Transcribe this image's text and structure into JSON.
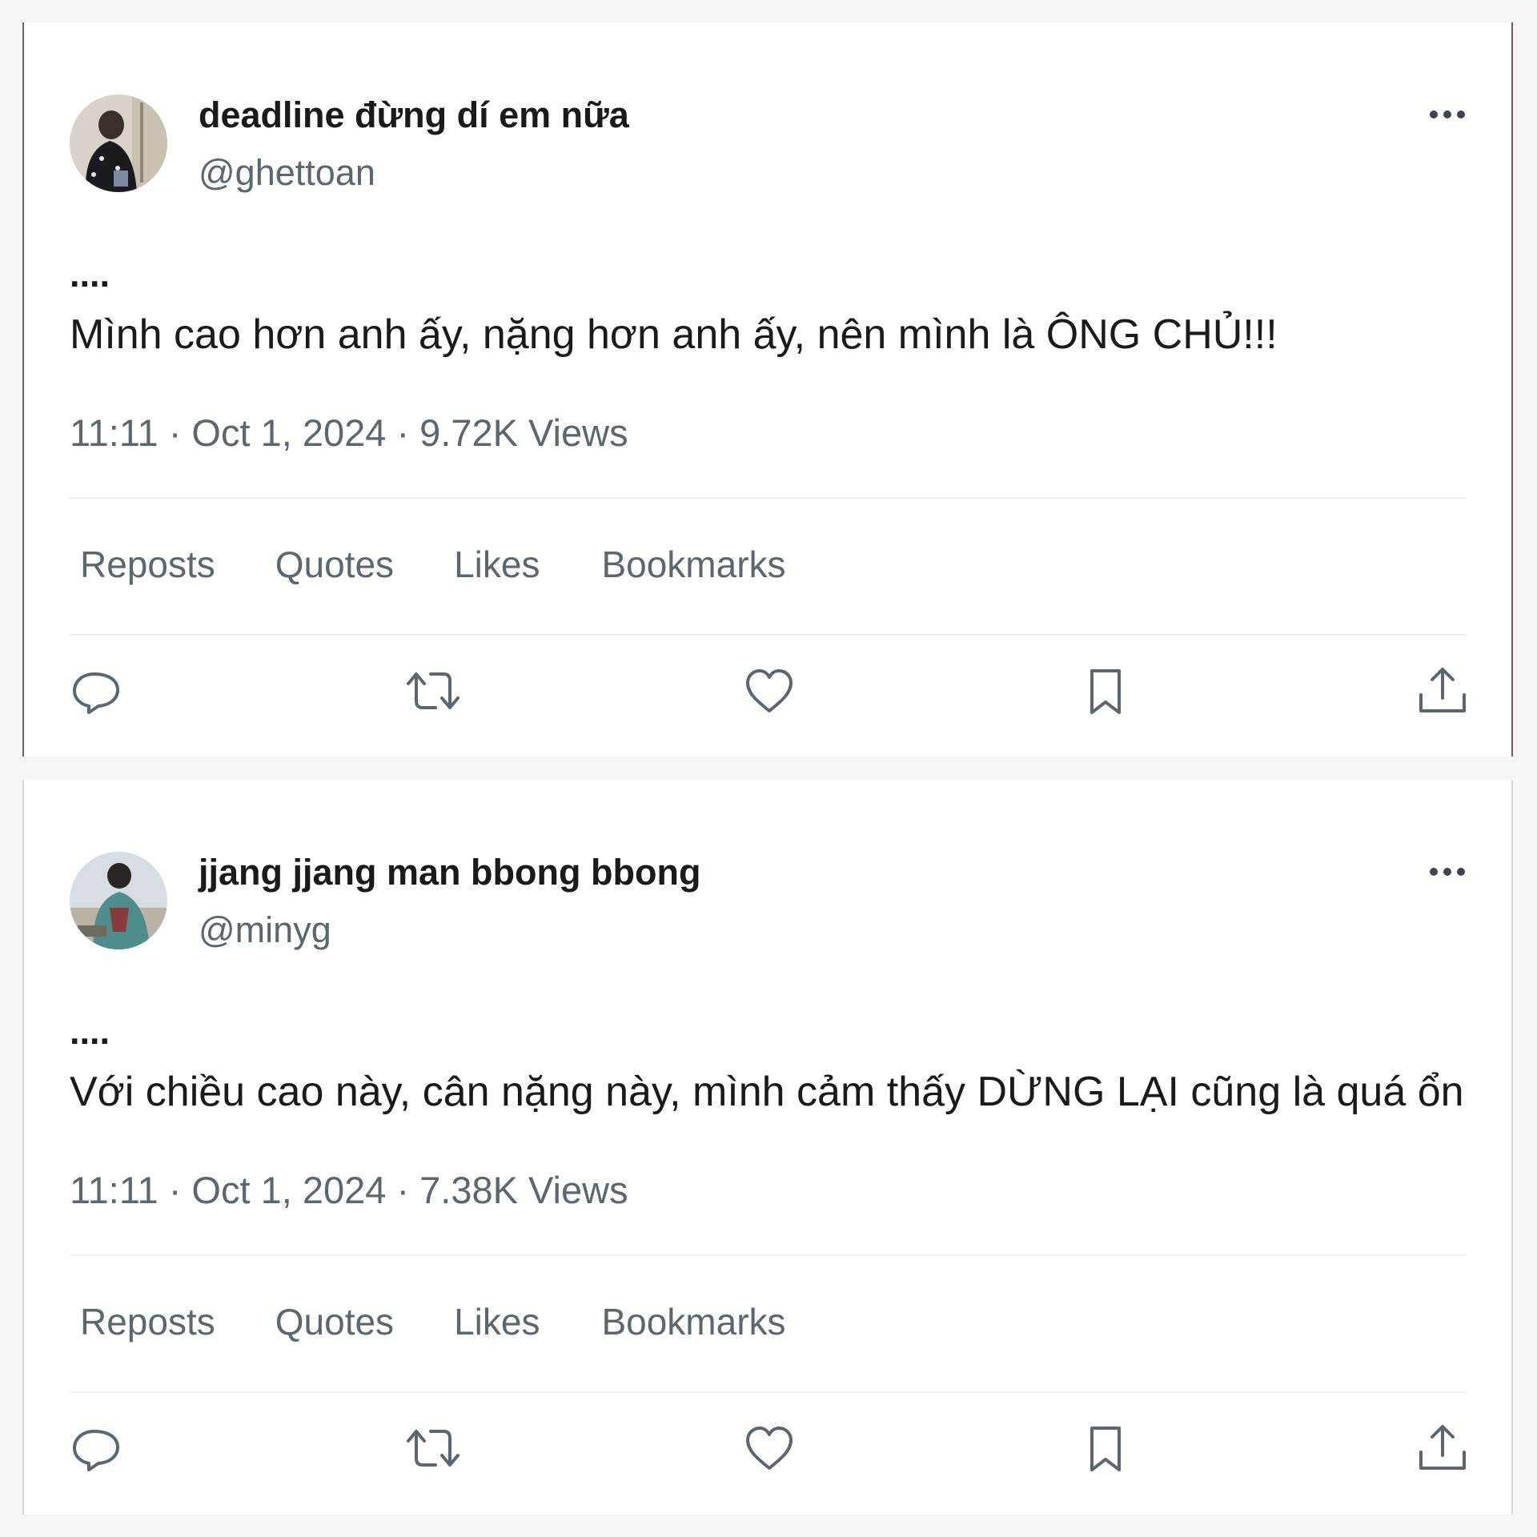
{
  "tweets": [
    {
      "display_name": "deadline đừng dí em nữa",
      "handle": "@ghettoan",
      "dots": "....",
      "text": "Mình cao hơn anh ấy, nặng hơn anh ấy, nên mình là ÔNG CHỦ!!!",
      "meta": "11:11 · Oct 1, 2024 · 9.72K Views",
      "stats": {
        "reposts": "Reposts",
        "quotes": "Quotes",
        "likes": "Likes",
        "bookmarks": "Bookmarks"
      }
    },
    {
      "display_name": "jjang jjang man bbong bbong",
      "handle": "@minyg",
      "dots": "....",
      "text": "Với chiều cao này, cân nặng này, mình cảm thấy DỪNG LẠI cũng là quá ổn",
      "meta": "11:11 · Oct 1, 2024 · 7.38K Views",
      "stats": {
        "reposts": "Reposts",
        "quotes": "Quotes",
        "likes": "Likes",
        "bookmarks": "Bookmarks"
      }
    }
  ],
  "icons": {
    "more": "more-icon",
    "reply": "reply-icon",
    "repost": "repost-icon",
    "like": "like-icon",
    "bookmark": "bookmark-icon",
    "share": "share-icon"
  },
  "colors": {
    "text_primary": "#1a1a1a",
    "text_secondary": "#5b6770",
    "divider": "#eeeeee",
    "icon": "#5b6770"
  }
}
